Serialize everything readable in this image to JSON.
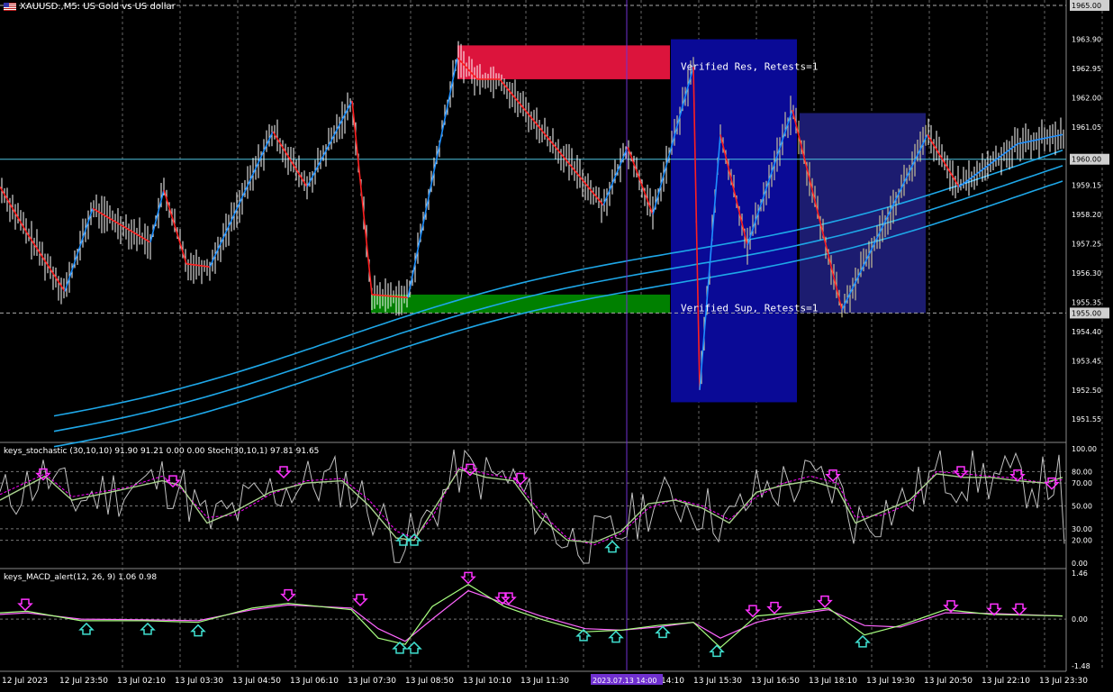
{
  "symbol_header": "XAUUSD.,M5:  US Gold vs US dollar",
  "colors": {
    "background": "#000000",
    "up_leg": "#1e90ff",
    "down_leg": "#ff2020",
    "ma_band": "#1ea7e8",
    "resistance_zone": "#dc143c",
    "support_zone": "#008000",
    "verified_box": "#0a0a96",
    "second_box": "#1c1c70",
    "hline": "#4fc3e0",
    "stoch_main": "#a8d08d",
    "stoch_signal": "#ff00ff",
    "stoch_raw": "#c0c0c0",
    "macd_main": "#a8ff80",
    "macd_signal": "#ff66ff",
    "arrow_up": "#40e0d0",
    "arrow_down": "#ff33ff",
    "cursor_line": "#7030d0",
    "price_bar": "#ffffff"
  },
  "price_axis": {
    "labels": [
      "1965.00",
      "1963.90",
      "1962.95",
      "1962.00",
      "1961.05",
      "1960.00",
      "1959.15",
      "1958.20",
      "1957.25",
      "1956.30",
      "1955.35",
      "1955.00",
      "1954.40",
      "1953.45",
      "1952.50",
      "1951.55"
    ],
    "highlighted": [
      "1965.00",
      "1960.00",
      "1955.00"
    ]
  },
  "time_axis": {
    "labels": [
      "12 Jul 2023",
      "12 Jul 23:50",
      "13 Jul 02:10",
      "13 Jul 03:30",
      "13 Jul 04:50",
      "13 Jul 06:10",
      "13 Jul 07:30",
      "13 Jul 08:50",
      "13 Jul 10:10",
      "13 Jul 11:30",
      "",
      "13 Jul 14:10",
      "13 Jul 15:30",
      "13 Jul 16:50",
      "13 Jul 18:10",
      "13 Jul 19:30",
      "13 Jul 20:50",
      "13 Jul 22:10",
      "13 Jul 23:30"
    ],
    "cursor_label": "2023.07.13 14:00"
  },
  "zones": {
    "resistance_label": "Verified Res, Retests=1",
    "support_label": "Verified Sup, Retests=1"
  },
  "stoch_panel": {
    "header": "keys_stochastic (30,10,10) 91.90 91.21 0.00 0.00 Stoch(30,10,1) 97.81 91.65",
    "levels": [
      "100.00",
      "80.00",
      "70.00",
      "50.00",
      "30.00",
      "20.00",
      "0.00"
    ]
  },
  "macd_panel": {
    "header": "keys_MACD_alert(12, 26, 9) 1.06 0.98",
    "levels": [
      "1.46",
      "0.00",
      "-1.48"
    ]
  },
  "chart_data": [
    {
      "type": "line",
      "title": "XAUUSD.,M5:  US Gold vs US dollar",
      "ylim": [
        1951.0,
        1965.0
      ],
      "zigzag_x": [
        0,
        30,
        72,
        103,
        167,
        182,
        207,
        233,
        303,
        341,
        391,
        413,
        453,
        508,
        530,
        555,
        670,
        697,
        725,
        770,
        777,
        800,
        830,
        880,
        935,
        1030,
        1065,
        1130,
        1180
      ],
      "zigzag_y": [
        1959.1,
        1957.6,
        1955.7,
        1958.4,
        1957.3,
        1959.0,
        1956.6,
        1956.5,
        1960.9,
        1959.1,
        1961.9,
        1955.6,
        1955.5,
        1963.3,
        1962.6,
        1962.6,
        1958.5,
        1960.4,
        1958.2,
        1963.0,
        1952.5,
        1960.8,
        1957.2,
        1961.6,
        1955.1,
        1960.8,
        1959.1,
        1960.5,
        1960.8
      ],
      "horizontal_lines": [
        1965.0,
        1960.0,
        1955.0
      ],
      "resistance_zone": [
        1962.6,
        1963.7
      ],
      "support_zone": [
        1955.0,
        1955.6
      ]
    },
    {
      "type": "line",
      "title": "keys_stochastic (30,10,10) 91.90 91.21 0.00 0.00 Stoch(30,10,1) 97.81 91.65",
      "ylim": [
        0,
        100
      ],
      "main_x": [
        0,
        50,
        80,
        110,
        140,
        180,
        200,
        230,
        260,
        300,
        340,
        380,
        410,
        440,
        460,
        480,
        510,
        540,
        570,
        600,
        630,
        660,
        690,
        720,
        750,
        780,
        810,
        840,
        870,
        900,
        930,
        950,
        980,
        1010,
        1040,
        1070,
        1100,
        1130,
        1160,
        1180
      ],
      "main_y": [
        55,
        76,
        55,
        60,
        65,
        72,
        68,
        35,
        45,
        62,
        70,
        72,
        50,
        22,
        20,
        45,
        82,
        75,
        72,
        40,
        20,
        18,
        28,
        52,
        55,
        48,
        35,
        62,
        68,
        72,
        65,
        35,
        45,
        55,
        78,
        75,
        75,
        72,
        70,
        75
      ],
      "signal_x": [
        0,
        50,
        80,
        110,
        140,
        180,
        200,
        230,
        260,
        300,
        340,
        380,
        410,
        440,
        460,
        480,
        510,
        540,
        570,
        600,
        630,
        660,
        690,
        720,
        750,
        780,
        810,
        840,
        870,
        900,
        930,
        950,
        980,
        1010,
        1040,
        1070,
        1100,
        1130,
        1160,
        1180
      ],
      "signal_y": [
        60,
        78,
        58,
        62,
        66,
        76,
        66,
        40,
        42,
        60,
        72,
        74,
        55,
        28,
        22,
        40,
        84,
        78,
        74,
        45,
        22,
        16,
        26,
        48,
        56,
        50,
        38,
        58,
        70,
        76,
        70,
        40,
        42,
        52,
        80,
        78,
        76,
        74,
        70,
        73
      ]
    },
    {
      "type": "line",
      "title": "keys_MACD_alert(12, 26, 9) 1.06 0.98",
      "ylim": [
        -1.48,
        1.46
      ],
      "main_x": [
        0,
        30,
        90,
        160,
        220,
        280,
        320,
        390,
        420,
        450,
        480,
        520,
        560,
        600,
        650,
        690,
        730,
        770,
        800,
        840,
        880,
        920,
        960,
        1000,
        1050,
        1100,
        1180
      ],
      "main_y": [
        0.2,
        0.25,
        -0.05,
        -0.05,
        -0.1,
        0.35,
        0.5,
        0.3,
        -0.6,
        -0.8,
        0.4,
        1.1,
        0.4,
        0.0,
        -0.4,
        -0.35,
        -0.2,
        -0.1,
        -0.9,
        0.1,
        0.2,
        0.35,
        -0.5,
        -0.2,
        0.3,
        0.15,
        0.1
      ],
      "signal_x": [
        0,
        30,
        90,
        160,
        220,
        280,
        320,
        390,
        420,
        450,
        480,
        520,
        560,
        600,
        650,
        690,
        730,
        770,
        800,
        840,
        880,
        920,
        960,
        1000,
        1050,
        1100,
        1180
      ],
      "signal_y": [
        0.15,
        0.2,
        0.0,
        -0.02,
        -0.05,
        0.3,
        0.45,
        0.35,
        -0.3,
        -0.7,
        0.0,
        0.9,
        0.5,
        0.1,
        -0.3,
        -0.35,
        -0.25,
        -0.1,
        -0.6,
        -0.1,
        0.15,
        0.3,
        -0.2,
        -0.25,
        0.2,
        0.18,
        0.1
      ]
    }
  ]
}
